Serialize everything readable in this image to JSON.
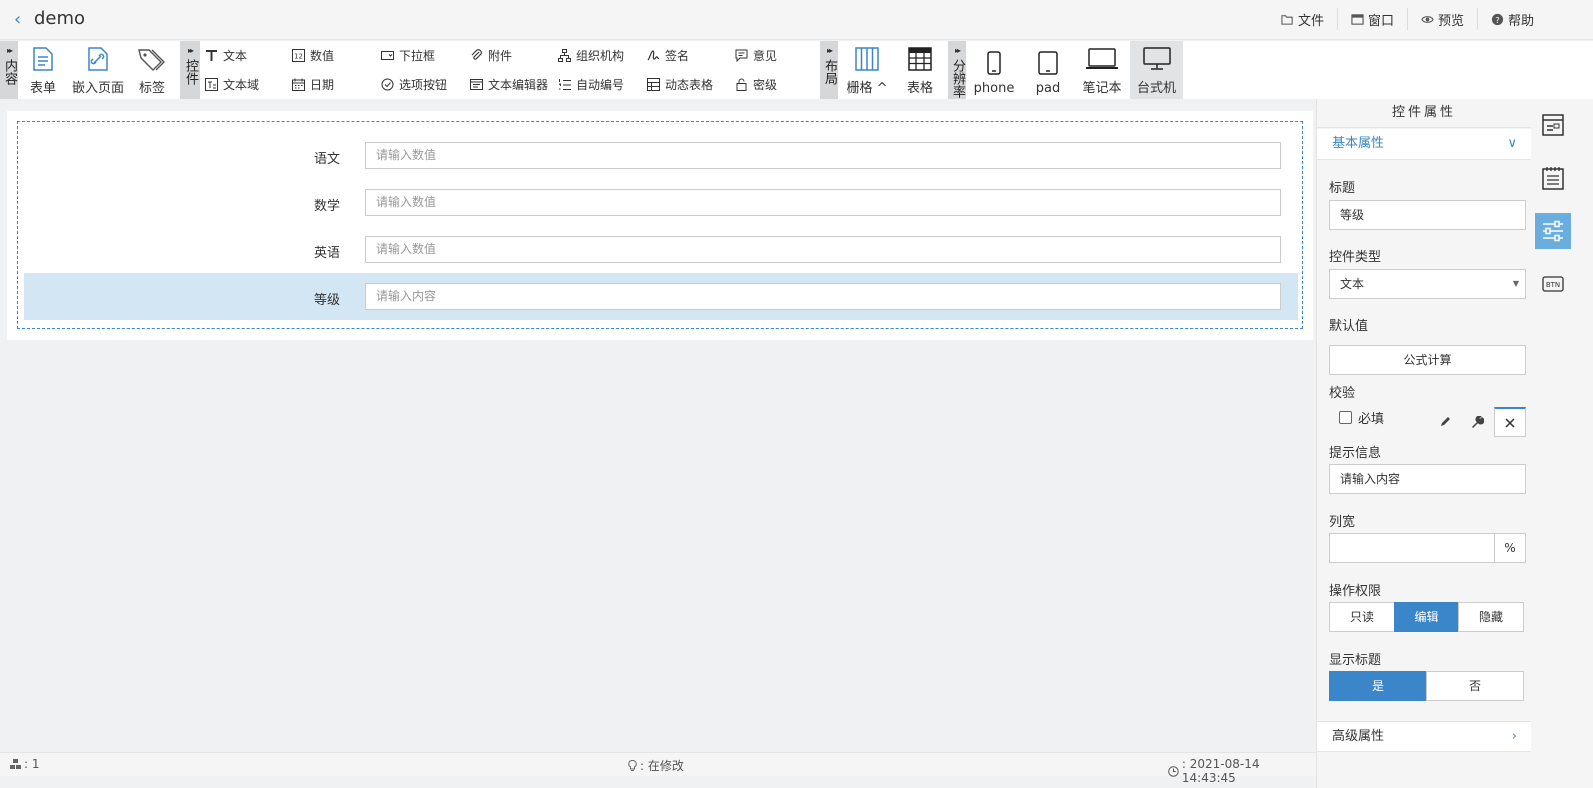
{
  "header": {
    "back_icon": "chevron-left-icon",
    "title": "demo",
    "menu": [
      {
        "icon": "folder-open-icon",
        "label": "文件"
      },
      {
        "icon": "window-icon",
        "label": "窗口"
      },
      {
        "icon": "eye-icon",
        "label": "预览"
      },
      {
        "icon": "question-circle-icon",
        "label": "帮助"
      }
    ]
  },
  "toolbar": {
    "groups": {
      "content": "内容",
      "controls": "控件",
      "layout": "布局",
      "resolution": "分辨率"
    },
    "content_items": [
      {
        "icon": "form-document-icon",
        "label": "表单"
      },
      {
        "icon": "embed-link-icon",
        "label": "嵌入页面"
      },
      {
        "icon": "tags-icon",
        "label": "标签"
      }
    ],
    "controls_top": [
      {
        "icon": "text-icon",
        "label": "文本"
      },
      {
        "icon": "number-icon",
        "label": "数值"
      },
      {
        "icon": "dropdown-icon",
        "label": "下拉框"
      },
      {
        "icon": "paperclip-icon",
        "label": "附件"
      },
      {
        "icon": "org-chart-icon",
        "label": "组织机构"
      },
      {
        "icon": "signature-icon",
        "label": "签名"
      },
      {
        "icon": "comment-icon",
        "label": "意见"
      }
    ],
    "controls_bottom": [
      {
        "icon": "textarea-icon",
        "label": "文本域"
      },
      {
        "icon": "calendar-icon",
        "label": "日期"
      },
      {
        "icon": "option-button-icon",
        "label": "选项按钮"
      },
      {
        "icon": "text-editor-icon",
        "label": "文本编辑器"
      },
      {
        "icon": "list-numbered-icon",
        "label": "自动编号"
      },
      {
        "icon": "dynamic-table-icon",
        "label": "动态表格"
      },
      {
        "icon": "lock-icon",
        "label": "密级"
      }
    ],
    "layout_items": [
      {
        "icon": "grid-columns-icon",
        "label": "栅格 ^"
      },
      {
        "icon": "table-icon",
        "label": "表格"
      }
    ],
    "resolution_items": [
      {
        "icon": "phone-icon",
        "label": "phone"
      },
      {
        "icon": "tablet-icon",
        "label": "pad"
      },
      {
        "icon": "laptop-icon",
        "label": "笔记本"
      },
      {
        "icon": "desktop-icon",
        "label": "台式机"
      }
    ],
    "active_resolution": "台式机"
  },
  "form": {
    "rows": [
      {
        "label": "语文",
        "placeholder": "请输入数值",
        "selected": false
      },
      {
        "label": "数学",
        "placeholder": "请输入数值",
        "selected": false
      },
      {
        "label": "英语",
        "placeholder": "请输入数值",
        "selected": false
      },
      {
        "label": "等级",
        "placeholder": "请输入内容",
        "selected": true
      }
    ]
  },
  "statusbar": {
    "count": ": 1",
    "state": ": 在修改",
    "time": ": 2021-08-14 14:43:45"
  },
  "panel": {
    "title": "控件属性",
    "basic_section": "基本属性",
    "title_label": "标题",
    "title_value": "等级",
    "type_label": "控件类型",
    "type_value": "文本",
    "default_label": "默认值",
    "formula_button": "公式计算",
    "validate_label": "校验",
    "required_label": "必填",
    "required_checked": false,
    "hint_label": "提示信息",
    "hint_value": "请输入内容",
    "width_label": "列宽",
    "width_value": "",
    "width_unit": "%",
    "permission_label": "操作权限",
    "permission_options": [
      "只读",
      "编辑",
      "隐藏"
    ],
    "permission_selected": "编辑",
    "show_title_label": "显示标题",
    "show_title_options": [
      "是",
      "否"
    ],
    "show_title_selected": "是",
    "advanced_section": "高级属性"
  },
  "colors": {
    "accent": "#3a86c8",
    "selected_row": "#d2e6f3",
    "rail_active": "#6aaee0"
  }
}
